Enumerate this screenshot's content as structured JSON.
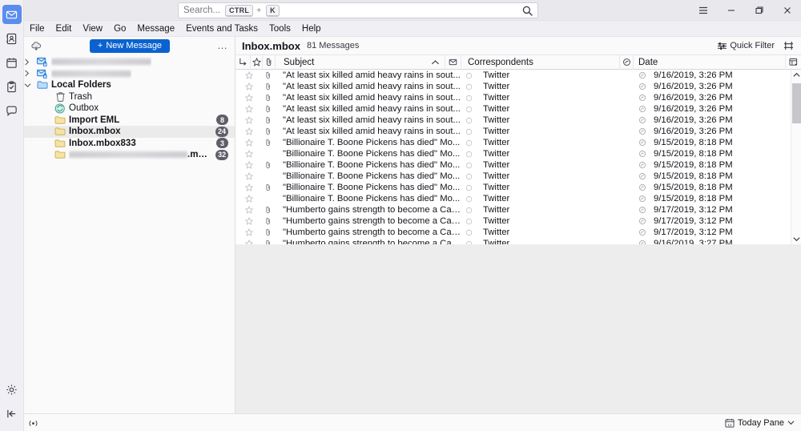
{
  "window": {
    "app_icon": "mail-icon",
    "controls": [
      {
        "name": "app-menu-button",
        "icon": "hamburger-icon"
      },
      {
        "name": "minimize-button",
        "icon": "minimize-icon"
      },
      {
        "name": "restore-button",
        "icon": "restore-icon"
      },
      {
        "name": "close-button",
        "icon": "close-icon"
      }
    ]
  },
  "search": {
    "placeholder": "Search...",
    "key1": "CTRL",
    "plus": "+",
    "key2": "K",
    "icon": "search-icon"
  },
  "menubar": {
    "items": [
      "File",
      "Edit",
      "View",
      "Go",
      "Message",
      "Events and Tasks",
      "Tools",
      "Help"
    ]
  },
  "rail": {
    "items": [
      {
        "label": "Mail",
        "icon": "mail-icon",
        "active": true
      },
      {
        "label": "Address Book",
        "icon": "address-book-icon",
        "active": false
      },
      {
        "label": "Calendar",
        "icon": "calendar-icon",
        "active": false
      },
      {
        "label": "Tasks",
        "icon": "tasks-icon",
        "active": false
      },
      {
        "label": "Chat",
        "icon": "chat-icon",
        "active": false
      }
    ],
    "bottom": [
      {
        "label": "Settings",
        "icon": "gear-icon"
      },
      {
        "label": "Collapse",
        "icon": "collapse-icon"
      }
    ]
  },
  "folder_pane": {
    "toolbar": {
      "fetch_icon": "get-messages-icon",
      "new_message_label": "New Message",
      "new_message_plus": "+",
      "more_label": "…"
    },
    "rows": [
      {
        "label": "",
        "blurred": true,
        "blur_width": 125,
        "indent": 0,
        "twisty": "collapsed",
        "icon": "account-mail-icon",
        "bold": false,
        "badge": "",
        "selected": false
      },
      {
        "label": "",
        "blurred": true,
        "blur_width": 100,
        "indent": 0,
        "twisty": "collapsed",
        "icon": "account-mail-icon",
        "bold": false,
        "badge": "",
        "selected": false
      },
      {
        "label": "Local Folders",
        "blurred": false,
        "blur_width": 0,
        "indent": 0,
        "twisty": "expanded",
        "icon": "folder-blue-icon",
        "bold": true,
        "badge": "",
        "selected": false
      },
      {
        "label": "Trash",
        "blurred": false,
        "blur_width": 0,
        "indent": 1,
        "twisty": "none",
        "icon": "trash-icon",
        "bold": false,
        "badge": "",
        "selected": false
      },
      {
        "label": "Outbox",
        "blurred": false,
        "blur_width": 0,
        "indent": 1,
        "twisty": "none",
        "icon": "outbox-icon",
        "bold": false,
        "badge": "",
        "selected": false
      },
      {
        "label": "Import EML",
        "blurred": false,
        "blur_width": 0,
        "indent": 1,
        "twisty": "none",
        "icon": "folder-icon",
        "bold": true,
        "badge": "8",
        "selected": false
      },
      {
        "label": "Inbox.mbox",
        "blurred": false,
        "blur_width": 0,
        "indent": 1,
        "twisty": "none",
        "icon": "folder-icon",
        "bold": true,
        "badge": "24",
        "selected": true
      },
      {
        "label": "Inbox.mbox833",
        "blurred": false,
        "blur_width": 0,
        "indent": 1,
        "twisty": "none",
        "icon": "folder-icon",
        "bold": true,
        "badge": "3",
        "selected": false
      },
      {
        "label": ".mbox",
        "blurred": true,
        "blur_width": 148,
        "indent": 1,
        "twisty": "none",
        "icon": "folder-icon",
        "bold": true,
        "badge": "32",
        "selected": false
      }
    ]
  },
  "message_pane": {
    "folder_title": "Inbox.mbox",
    "message_count": "81 Messages",
    "quick_filter_label": "Quick Filter",
    "quick_filter_icon": "filter-sliders-icon",
    "display_options_icon": "display-options-icon",
    "columns": [
      {
        "key": "thread",
        "label": "",
        "icon": "thread-icon"
      },
      {
        "key": "star",
        "label": "",
        "icon": "star-icon"
      },
      {
        "key": "attach",
        "label": "",
        "icon": "paperclip-icon"
      },
      {
        "key": "subject",
        "label": "Subject",
        "sort": "ascending",
        "sort_icon": "chevron-up-icon"
      },
      {
        "key": "unread",
        "label": "",
        "icon": "unread-icon"
      },
      {
        "key": "correspondents",
        "label": "Correspondents"
      },
      {
        "key": "datestar",
        "label": "",
        "icon": "spam-icon"
      },
      {
        "key": "date",
        "label": "Date"
      },
      {
        "key": "picker",
        "label": "",
        "icon": "column-picker-icon"
      }
    ],
    "rows": [
      {
        "subject": "\"At least six killed amid heavy rains in sout...",
        "correspondent": "Twitter",
        "date": "9/16/2019, 3:26 PM",
        "attachment": true
      },
      {
        "subject": "\"At least six killed amid heavy rains in sout...",
        "correspondent": "Twitter",
        "date": "9/16/2019, 3:26 PM",
        "attachment": true
      },
      {
        "subject": "\"At least six killed amid heavy rains in sout...",
        "correspondent": "Twitter",
        "date": "9/16/2019, 3:26 PM",
        "attachment": true
      },
      {
        "subject": "\"At least six killed amid heavy rains in sout...",
        "correspondent": "Twitter",
        "date": "9/16/2019, 3:26 PM",
        "attachment": true
      },
      {
        "subject": "\"At least six killed amid heavy rains in sout...",
        "correspondent": "Twitter",
        "date": "9/16/2019, 3:26 PM",
        "attachment": true
      },
      {
        "subject": "\"At least six killed amid heavy rains in sout...",
        "correspondent": "Twitter",
        "date": "9/16/2019, 3:26 PM",
        "attachment": true
      },
      {
        "subject": "\"Billionaire T. Boone Pickens has died\" Mo...",
        "correspondent": "Twitter",
        "date": "9/15/2019, 8:18 PM",
        "attachment": true
      },
      {
        "subject": "\"Billionaire T. Boone Pickens has died\" Mo...",
        "correspondent": "Twitter",
        "date": "9/15/2019, 8:18 PM",
        "attachment": false
      },
      {
        "subject": "\"Billionaire T. Boone Pickens has died\" Mo...",
        "correspondent": "Twitter",
        "date": "9/15/2019, 8:18 PM",
        "attachment": true
      },
      {
        "subject": "\"Billionaire T. Boone Pickens has died\" Mo...",
        "correspondent": "Twitter",
        "date": "9/15/2019, 8:18 PM",
        "attachment": false
      },
      {
        "subject": "\"Billionaire T. Boone Pickens has died\" Mo...",
        "correspondent": "Twitter",
        "date": "9/15/2019, 8:18 PM",
        "attachment": true
      },
      {
        "subject": "\"Billionaire T. Boone Pickens has died\" Mo...",
        "correspondent": "Twitter",
        "date": "9/15/2019, 8:18 PM",
        "attachment": false
      },
      {
        "subject": "\"Humberto gains strength to become a Cat...",
        "correspondent": "Twitter",
        "date": "9/17/2019, 3:12 PM",
        "attachment": true
      },
      {
        "subject": "\"Humberto gains strength to become a Cat...",
        "correspondent": "Twitter",
        "date": "9/17/2019, 3:12 PM",
        "attachment": true
      },
      {
        "subject": "\"Humberto gains strength to become a Cat...",
        "correspondent": "Twitter",
        "date": "9/17/2019, 3:12 PM",
        "attachment": true
      },
      {
        "subject": "\"Humberto gains strength to become a Cat...",
        "correspondent": "Twitter",
        "date": "9/16/2019, 3:27 PM",
        "attachment": true
      }
    ],
    "scrollbar": {
      "up_icon": "chevron-up-icon",
      "down_icon": "chevron-down-icon"
    }
  },
  "statusbar": {
    "connection_icon": "connection-icon",
    "today_pane_label": "Today Pane",
    "today_pane_icon": "calendar-day-icon",
    "today_pane_chevron": "chevron-down-icon"
  },
  "colors": {
    "accent": "#0a62d0",
    "rail_active": "#5b8def",
    "badge": "#5f5f6b",
    "folder_yellow": "#f3d17a"
  }
}
